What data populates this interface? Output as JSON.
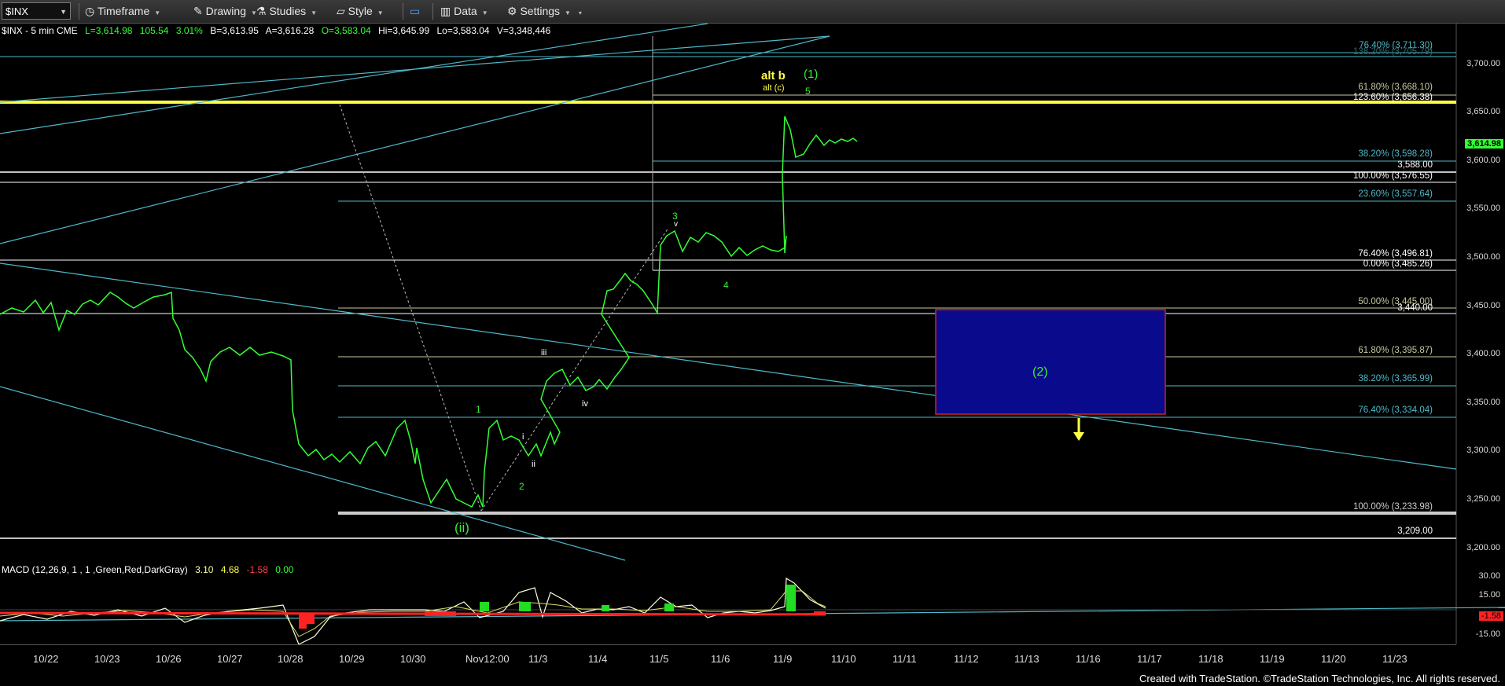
{
  "toolbar": {
    "symbol": "$INX",
    "items": [
      "Timeframe",
      "Drawing",
      "Studies",
      "Style",
      "Data",
      "Settings"
    ]
  },
  "info": {
    "name": "$INX - 5 min  CME",
    "last": "L=3,614.98",
    "change": "105.54",
    "pct": "3.01%",
    "bid": "B=3,613.95",
    "ask": "A=3,616.28",
    "open": "O=3,583.04",
    "high": "Hi=3,645.99",
    "low": "Lo=3,583.04",
    "vol": "V=3,348,446"
  },
  "macd": {
    "label": "MACD (12,26,9, 1 , 1 ,Green,Red,DarkGray)",
    "v1": "3.10",
    "v2": "4.68",
    "v3": "-1.58",
    "v4": "0.00",
    "axis": [
      "30.00",
      "15.00",
      "-15.00"
    ],
    "last_tag": "-1.58"
  },
  "price_axis": [
    "3,700.00",
    "3,650.00",
    "3,600.00",
    "3,550.00",
    "3,500.00",
    "3,450.00",
    "3,400.00",
    "3,350.00",
    "3,300.00",
    "3,250.00",
    "3,200.00"
  ],
  "last_price_tag": "3,614.98",
  "date_axis": [
    "10/22",
    "10/23",
    "10/26",
    "10/27",
    "10/28",
    "10/29",
    "10/30",
    "Nov12:00",
    "11/3",
    "11/4",
    "11/5",
    "11/6",
    "11/9",
    "11/10",
    "11/11",
    "11/12",
    "11/13",
    "11/16",
    "11/17",
    "11/18",
    "11/19",
    "11/20",
    "11/23"
  ],
  "fib_labels": [
    "76.40% (3,711.30)",
    "138.20% (3,705.79)",
    "61.80% (3,668.10)",
    "123.60% (3,656.38)",
    "38.20% (3,598.28)",
    "3,588.00",
    "100.00% (3,576.55)",
    "23.60% (3,557.64)",
    "76.40% (3,496.81)",
    "0.00% (3,485.26)",
    "50.00% (3,445.00)",
    "3,440.00",
    "61.80% (3,395.87)",
    "38.20% (3,365.99)",
    "76.40% (3,334.04)",
    "100.00% (3,233.98)",
    "3,209.00"
  ],
  "wave_labels": {
    "alt_b": "alt b",
    "alt_c": "alt (c)",
    "w1_paren": "(1)",
    "w5": "5",
    "w3": "3",
    "wv": "v",
    "w4": "4",
    "wiii": "iii",
    "wiv": "iv",
    "w1": "1",
    "wi": "i",
    "wii": "ii",
    "w2": "2",
    "wii_paren": "(ii)",
    "w2_paren": "(2)"
  },
  "footer": "Created with TradeStation. ©TradeStation Technologies, Inc. All rights reserved.",
  "colors": {
    "price": "#33ff33",
    "yellow": "#ffff44",
    "cyan": "#4fb8c8",
    "box": "#0a0a8c",
    "box_border": "#cc2222"
  }
}
